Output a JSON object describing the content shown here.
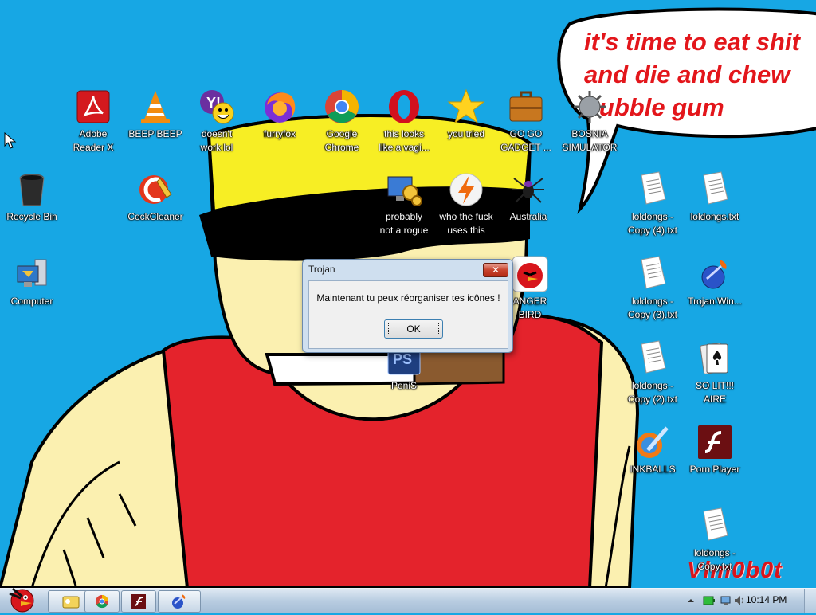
{
  "bubble": {
    "text": "it's time to eat shit\nand die and chew\nbubble gum"
  },
  "watermark": "Vlm0b0t",
  "icons": [
    {
      "label": "Recycle Bin",
      "icon": "recycle-bin-icon"
    },
    {
      "label": "Computer",
      "icon": "computer-icon"
    },
    {
      "label": "Adobe\nReader X",
      "icon": "adobe-reader-icon"
    },
    {
      "label": "BEEP BEEP",
      "icon": "vlc-cone-icon"
    },
    {
      "label": "doesn't\nwork lol",
      "icon": "yahoo-messenger-icon"
    },
    {
      "label": "furryfox",
      "icon": "firefox-icon"
    },
    {
      "label": "Google\nChrome",
      "icon": "chrome-icon"
    },
    {
      "label": "this looks\nlike a vagi...",
      "icon": "opera-icon"
    },
    {
      "label": "you tried",
      "icon": "star-icon"
    },
    {
      "label": "GO GO\nGADGET ...",
      "icon": "briefcase-icon"
    },
    {
      "label": "BOSNIA\nSIMULATOR",
      "icon": "spiked-mine-icon"
    },
    {
      "label": "CockCleaner",
      "icon": "ccleaner-icon"
    },
    {
      "label": "probably\nnot a rogue",
      "icon": "gears-monitor-icon"
    },
    {
      "label": "who the fuck\nuses this",
      "icon": "lightning-icon"
    },
    {
      "label": "Australia",
      "icon": "spider-icon"
    },
    {
      "label": "ANGER\nBIRD",
      "icon": "angry-bird-icon"
    },
    {
      "label": "PeniS",
      "icon": "photoshop-icon"
    },
    {
      "label": "loldongs -\nCopy (4).txt",
      "icon": "text-file-icon"
    },
    {
      "label": "loldongs.txt",
      "icon": "text-file-icon"
    },
    {
      "label": "loldongs -\nCopy (3).txt",
      "icon": "text-file-icon"
    },
    {
      "label": "Trojan.Win...",
      "icon": "trojan-horse-icon"
    },
    {
      "label": "loldongs -\nCopy (2).txt",
      "icon": "text-file-icon"
    },
    {
      "label": "SO LIT!!!\nAIRE",
      "icon": "solitaire-icon"
    },
    {
      "label": "INKBALLS",
      "icon": "inkball-icon"
    },
    {
      "label": "Porn Player",
      "icon": "flash-player-icon"
    },
    {
      "label": "loldongs -\nCopy.txt",
      "icon": "text-file-icon"
    }
  ],
  "dialog": {
    "title": "Trojan",
    "message": "Maintenant tu peux réorganiser tes icônes !",
    "ok_label": "OK",
    "close_glyph": "✕"
  },
  "taskbar": {
    "start_icon": "angry-bird-start-icon",
    "buttons": [
      "explorer-icon",
      "chrome-icon",
      "flash-player-icon",
      "trojan-horse-icon"
    ],
    "time": "10:14 PM"
  }
}
